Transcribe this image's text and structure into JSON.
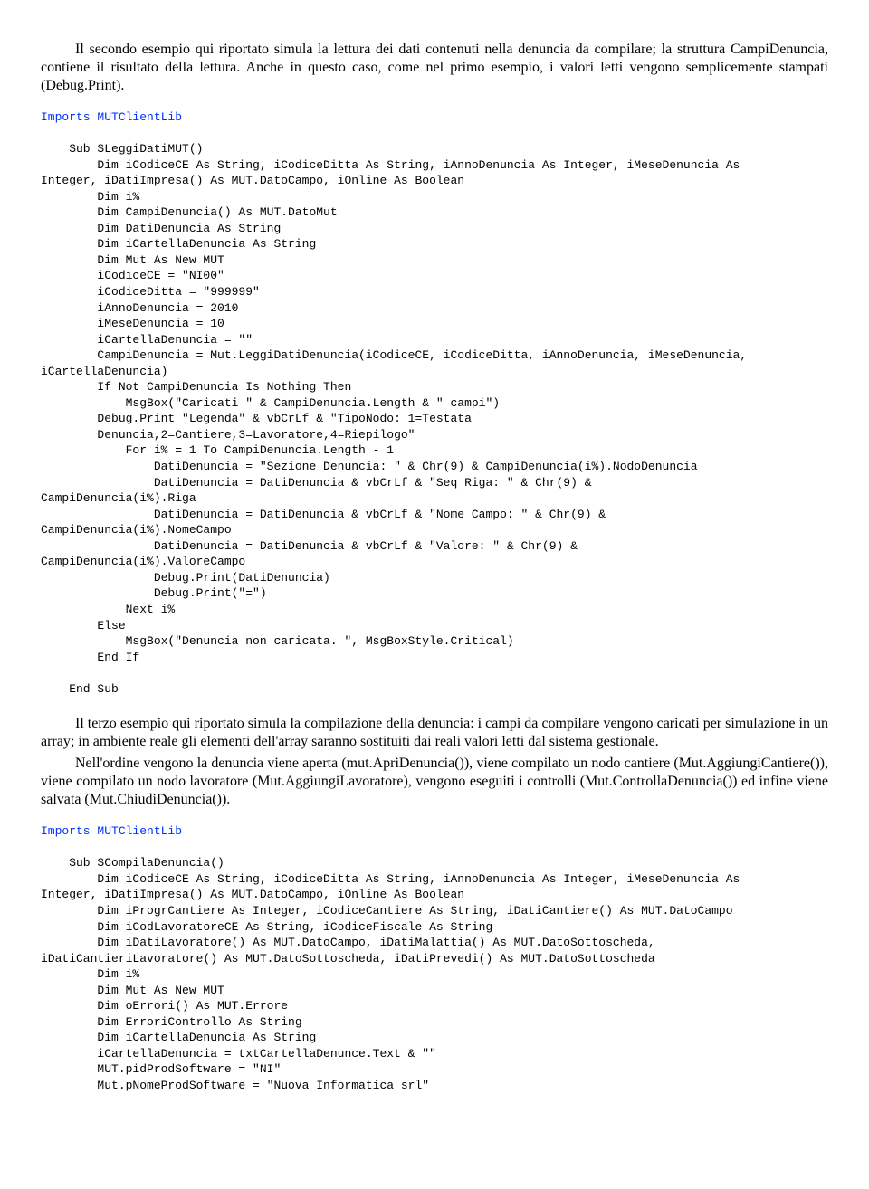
{
  "para1": "Il secondo esempio qui riportato simula la lettura dei dati contenuti nella denuncia da compilare; la struttura CampiDenuncia, contiene il risultato della lettura. Anche in questo caso, come nel primo esempio, i valori letti vengono semplicemente stampati (Debug.Print).",
  "code1_lead": "Imports MUTClientLib",
  "code1_body": "    Sub SLeggiDatiMUT()\n        Dim iCodiceCE As String, iCodiceDitta As String, iAnnoDenuncia As Integer, iMeseDenuncia As\nInteger, iDatiImpresa() As MUT.DatoCampo, iOnline As Boolean\n        Dim i%\n        Dim CampiDenuncia() As MUT.DatoMut\n        Dim DatiDenuncia As String\n        Dim iCartellaDenuncia As String\n        Dim Mut As New MUT\n        iCodiceCE = \"NI00\"\n        iCodiceDitta = \"999999\"\n        iAnnoDenuncia = 2010\n        iMeseDenuncia = 10\n        iCartellaDenuncia = \"\"\n        CampiDenuncia = Mut.LeggiDatiDenuncia(iCodiceCE, iCodiceDitta, iAnnoDenuncia, iMeseDenuncia,\niCartellaDenuncia)\n        If Not CampiDenuncia Is Nothing Then\n            MsgBox(\"Caricati \" & CampiDenuncia.Length & \" campi\")\n        Debug.Print \"Legenda\" & vbCrLf & \"TipoNodo: 1=Testata\n        Denuncia,2=Cantiere,3=Lavoratore,4=Riepilogo\"\n            For i% = 1 To CampiDenuncia.Length - 1\n                DatiDenuncia = \"Sezione Denuncia: \" & Chr(9) & CampiDenuncia(i%).NodoDenuncia\n                DatiDenuncia = DatiDenuncia & vbCrLf & \"Seq Riga: \" & Chr(9) &\nCampiDenuncia(i%).Riga\n                DatiDenuncia = DatiDenuncia & vbCrLf & \"Nome Campo: \" & Chr(9) &\nCampiDenuncia(i%).NomeCampo\n                DatiDenuncia = DatiDenuncia & vbCrLf & \"Valore: \" & Chr(9) &\nCampiDenuncia(i%).ValoreCampo\n                Debug.Print(DatiDenuncia)\n                Debug.Print(\"=\")\n            Next i%\n        Else\n            MsgBox(\"Denuncia non caricata. \", MsgBoxStyle.Critical)\n        End If\n\n    End Sub",
  "para2a": "Il terzo esempio qui riportato simula la compilazione della denuncia: i campi da compilare vengono caricati per simulazione in un array;  in ambiente reale gli elementi dell'array saranno sostituiti dai reali valori letti dal sistema gestionale.",
  "para2b": "Nell'ordine vengono la denuncia viene aperta (mut.ApriDenuncia()), viene compilato un nodo cantiere (Mut.AggiungiCantiere()), viene compilato un nodo lavoratore (Mut.AggiungiLavoratore), vengono eseguiti i controlli (Mut.ControllaDenuncia()) ed infine viene salvata (Mut.ChiudiDenuncia()).",
  "code2_lead": "Imports MUTClientLib",
  "code2_body": "    Sub SCompilaDenuncia()\n        Dim iCodiceCE As String, iCodiceDitta As String, iAnnoDenuncia As Integer, iMeseDenuncia As\nInteger, iDatiImpresa() As MUT.DatoCampo, iOnline As Boolean\n        Dim iProgrCantiere As Integer, iCodiceCantiere As String, iDatiCantiere() As MUT.DatoCampo\n        Dim iCodLavoratoreCE As String, iCodiceFiscale As String\n        Dim iDatiLavoratore() As MUT.DatoCampo, iDatiMalattia() As MUT.DatoSottoscheda,\niDatiCantieriLavoratore() As MUT.DatoSottoscheda, iDatiPrevedi() As MUT.DatoSottoscheda\n        Dim i%\n        Dim Mut As New MUT\n        Dim oErrori() As MUT.Errore\n        Dim ErroriControllo As String\n        Dim iCartellaDenuncia As String\n        iCartellaDenuncia = txtCartellaDenunce.Text & \"\"\n        MUT.pidProdSoftware = \"NI\"\n        Mut.pNomeProdSoftware = \"Nuova Informatica srl\""
}
